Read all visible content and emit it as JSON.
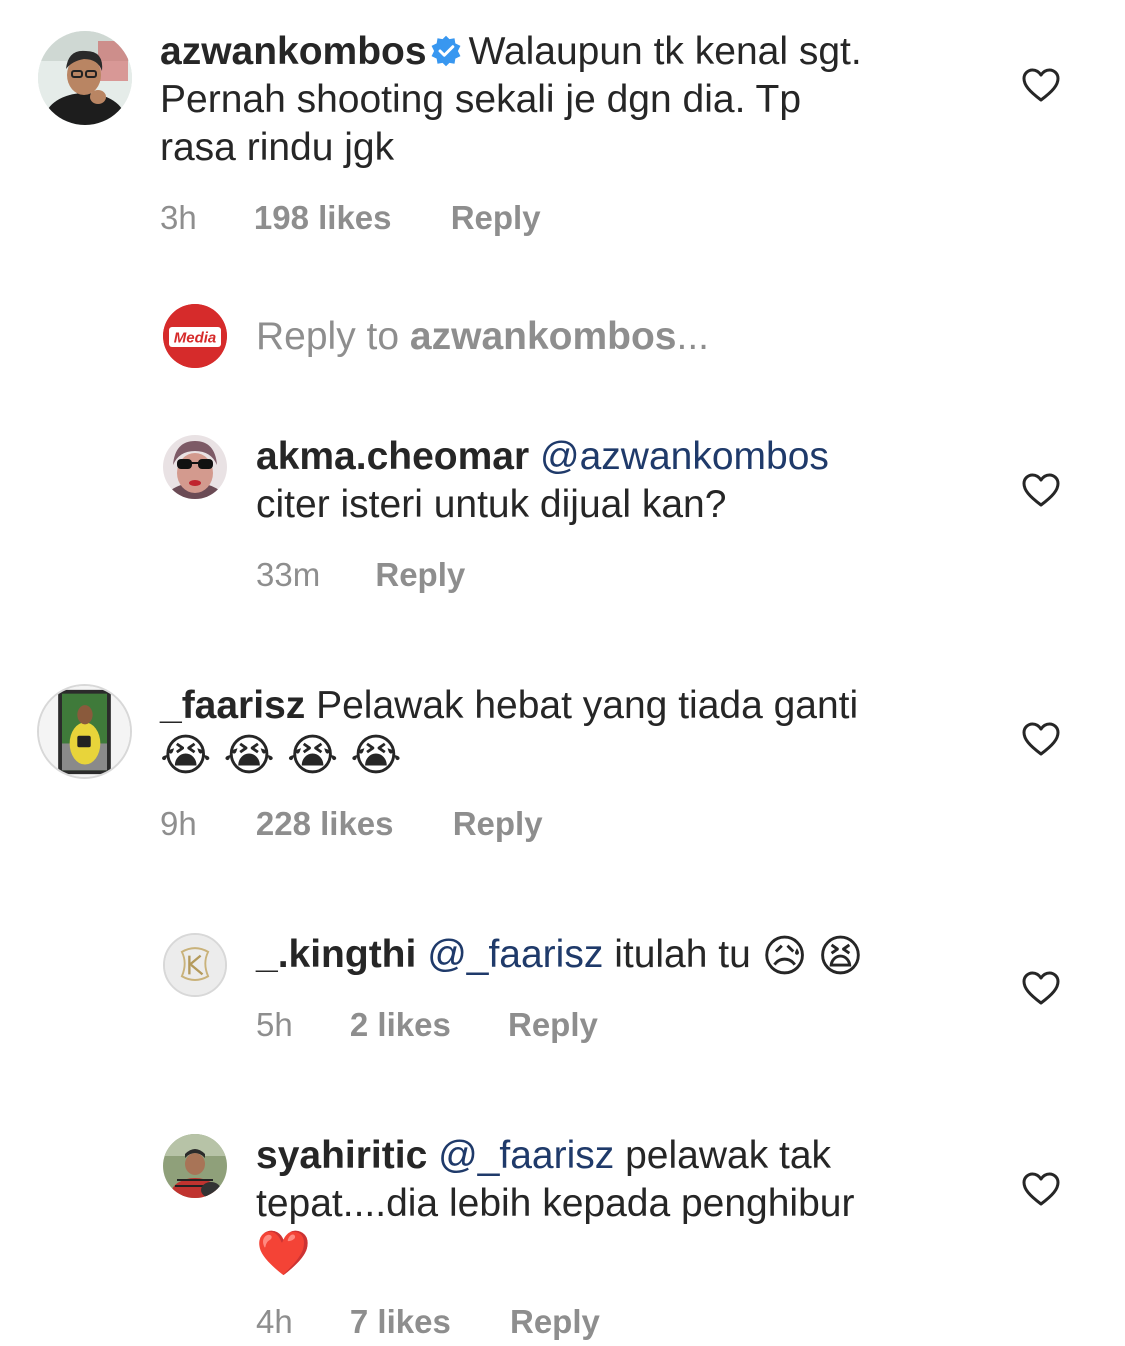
{
  "comments": [
    {
      "username": "azwankombos",
      "verified": true,
      "text_line1": "Walaupun tk kenal sgt.",
      "text_line2": "Pernah shooting sekali je dgn dia. Tp",
      "text_line3": "rasa rindu jgk",
      "time": "3h",
      "likes": "198 likes",
      "reply": "Reply"
    },
    {
      "username": "akma.cheomar",
      "mention": "@azwankombos",
      "text_line2": "citer isteri untuk dijual kan?",
      "time": "33m",
      "reply": "Reply"
    },
    {
      "username": "_faarisz",
      "text_line1": "Pelawak hebat yang tiada ganti",
      "emojis": "😭😭😭😭",
      "time": "9h",
      "likes": "228 likes",
      "reply": "Reply"
    },
    {
      "username": "_.kingthi",
      "mention": "@_faarisz",
      "text_line1": "itulah tu",
      "emojis": "😥😫",
      "time": "5h",
      "likes": "2 likes",
      "reply": "Reply"
    },
    {
      "username": "syahiritic",
      "mention": "@_faarisz",
      "text_line1": "pelawak tak",
      "text_line2": "tepat....dia lebih kepada penghibur",
      "emojis": "❤️",
      "time": "4h",
      "likes": "7 likes",
      "reply": "Reply"
    }
  ],
  "reply_box": {
    "prefix": "Reply to",
    "target": "azwankombos",
    "suffix": "..."
  },
  "media_logo_text": "Media",
  "icons": {
    "heart": "heart-outline-icon",
    "verified": "verified-badge-icon"
  },
  "colors": {
    "text": "#262626",
    "meta": "#8e8e8e",
    "mention": "#1f3a6a",
    "verified": "#3897f0",
    "media_red": "#d62b2b"
  }
}
